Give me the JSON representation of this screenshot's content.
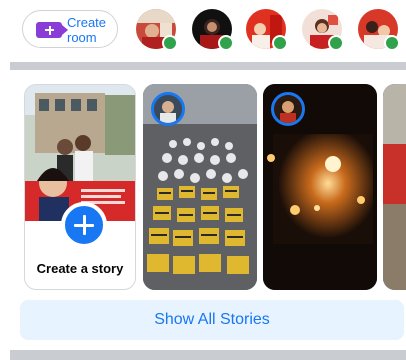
{
  "rooms": {
    "create_label_line1": "Create",
    "create_label_line2": "room",
    "icon": "video-plus-icon",
    "friends_online_count": 5
  },
  "stories": {
    "create_label": "Create a story",
    "create_icon": "plus-icon"
  },
  "show_all_label": "Show All Stories",
  "colors": {
    "accent": "#1877f2",
    "room_icon": "#8a3cd6",
    "online": "#31a24c",
    "divider": "#c9ccd1",
    "button_bg": "#e7f3ff"
  }
}
